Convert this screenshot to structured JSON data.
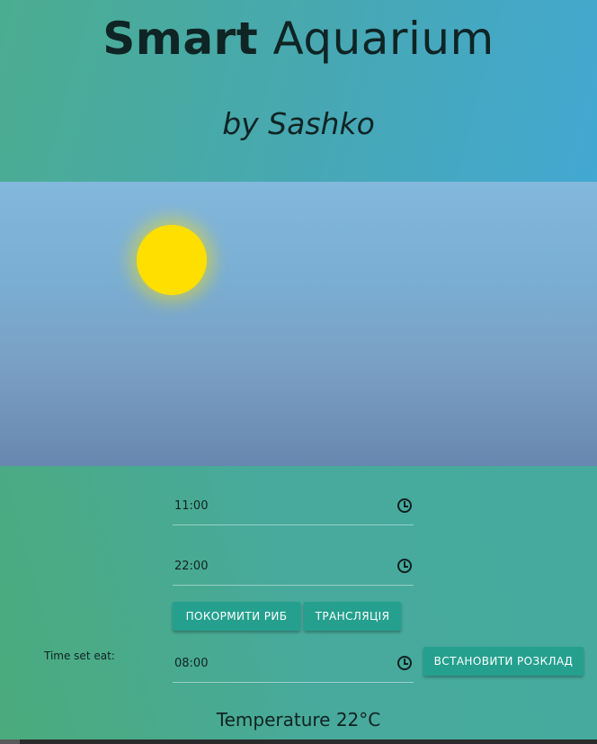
{
  "header": {
    "title_bold": "Smart",
    "title_light": "Aquarium",
    "subtitle": "by Sashko"
  },
  "schedule": {
    "time_1": "11:00",
    "time_2": "22:00",
    "feed_button": "ПОКОРМИТИ РИБ",
    "stream_button": "ТРАНСЛЯЦІЯ",
    "eat_label": "Time set eat:",
    "eat_time": "08:00",
    "set_schedule_button": "ВСТАНОВИТИ РОЗКЛАД"
  },
  "temperature": "Temperature 22°C",
  "colors": {
    "sun": "#ffdf00",
    "button": "#25a08f",
    "text": "#112222"
  },
  "icons": [
    "clock-icon",
    "sun-icon"
  ]
}
